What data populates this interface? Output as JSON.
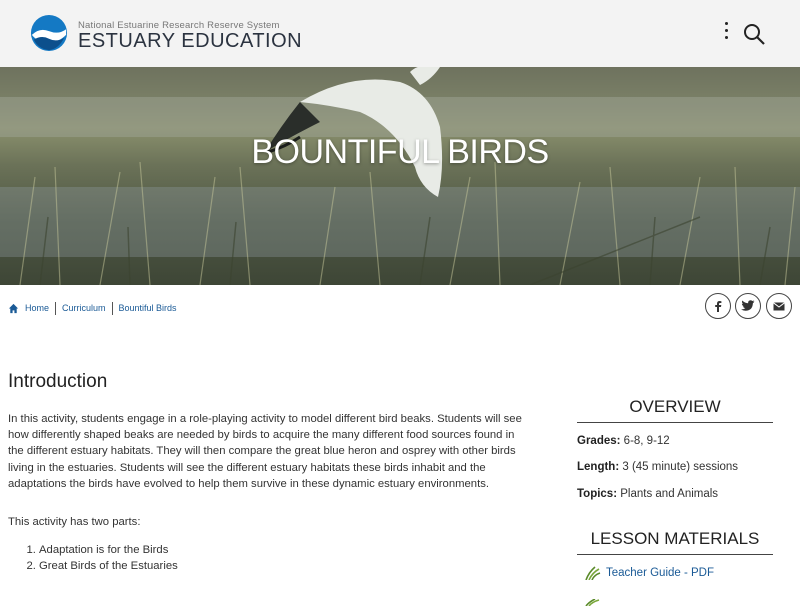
{
  "header": {
    "org_name": "National Estuarine Research Reserve System",
    "site_title": "ESTUARY EDUCATION"
  },
  "hero": {
    "title": "BOUNTIFUL BIRDS"
  },
  "breadcrumb": {
    "items": [
      "Home",
      "Curriculum",
      "Bountiful Birds"
    ]
  },
  "share": {
    "icons": [
      "facebook-icon",
      "twitter-icon",
      "email-icon"
    ]
  },
  "main": {
    "heading": "Introduction",
    "paragraph": "In this activity, students engage in a role-playing activity to model different bird beaks. Students will see how differently shaped beaks are needed by birds to acquire the many different food sources found in the different estuary habitats. They will then compare the great blue heron and osprey with other birds living in the estuaries. Students will see the different estuary habitats these birds inhabit and the adaptations the birds have evolved to help them survive in these dynamic estuary environments.",
    "parts_intro": "This activity has two parts:",
    "parts": [
      "Adaptation is for the Birds",
      "Great Birds of the Estuaries"
    ]
  },
  "sidebar": {
    "overview_title": "OVERVIEW",
    "grades_label": "Grades:",
    "grades_value": "6-8, 9-12",
    "length_label": "Length:",
    "length_value": "3 (45 minute) sessions",
    "topics_label": "Topics:",
    "topics_value": "Plants and Animals",
    "materials_title": "LESSON MATERIALS",
    "materials": [
      "Teacher Guide - PDF"
    ]
  },
  "colors": {
    "link": "#1a5a96",
    "header_bg": "#f3f3f3",
    "logo_blue": "#1479c4"
  }
}
